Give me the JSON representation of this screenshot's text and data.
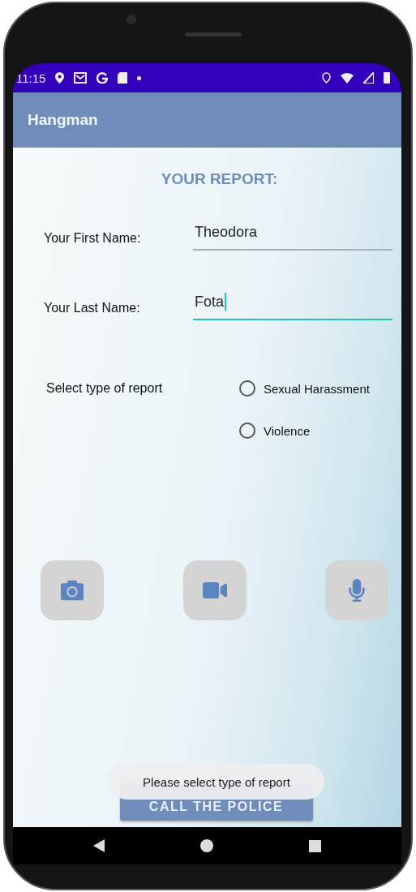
{
  "status_bar": {
    "time": "11:15"
  },
  "app_bar": {
    "title": "Hangman"
  },
  "heading": "YOUR REPORT:",
  "fields": [
    {
      "label": "Your First Name:",
      "value": "Theodora",
      "focused": false
    },
    {
      "label": "Your Last Name:",
      "value": "Fota",
      "focused": true
    }
  ],
  "report_type": {
    "label": "Select type of report",
    "options": [
      {
        "label": "Sexual Harassment",
        "selected": false
      },
      {
        "label": "Violence",
        "selected": false
      }
    ]
  },
  "call_button": {
    "label": "CALL THE POLICE"
  },
  "toast": {
    "message": "Please select type of report"
  }
}
